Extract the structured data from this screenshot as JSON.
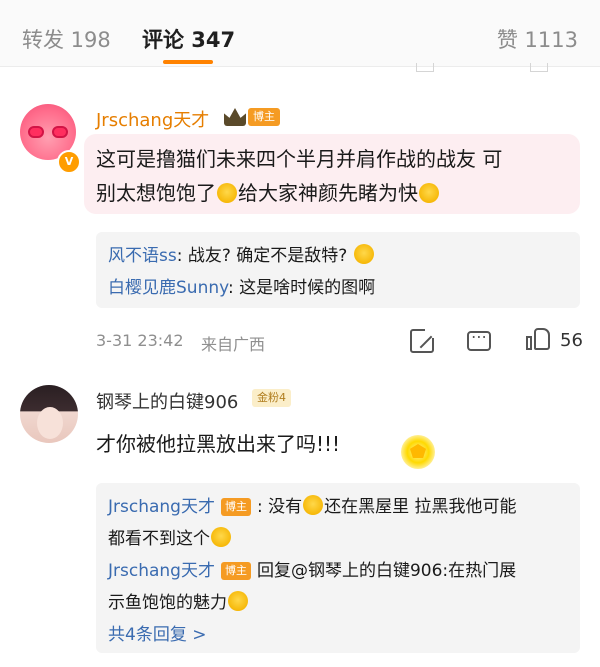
{
  "tabs": {
    "repost": "转发 198",
    "comments": "评论 347",
    "likes": "赞 1113"
  },
  "colors": {
    "accent": "#ff8200",
    "link": "#3a6bb0",
    "username_vip": "#e67e00"
  },
  "comments": [
    {
      "user": "Jrschang天才",
      "badge": "博主",
      "text_line1": "这可是撸猫们未来四个半月并肩作战的战友 可",
      "text_line2a": "别太想饱饱了",
      "text_line2b": "给大家神颜先睹为快",
      "replies": [
        {
          "name": "风不语ss",
          "text": ": 战友? 确定不是敌特? "
        },
        {
          "name": "白樱见鹿Sunny",
          "text": ": 这是啥时候的图啊"
        }
      ],
      "time": "3-31 23:42",
      "location": "来自广西",
      "like_count": "56"
    },
    {
      "user": "钢琴上的白键906",
      "fan_badge": "金粉4",
      "text": "才你被他拉黑放出来了吗!!!",
      "replies": [
        {
          "name": "Jrschang天才",
          "tag": "博主",
          "text_a": ": 没有",
          "text_b": "还在黑屋里 拉黑我他可能",
          "text_c": "都看不到这个"
        },
        {
          "name": "Jrschang天才",
          "tag": "博主",
          "text_a": "回复@钢琴上的白键906:在热门展",
          "text_c": "示鱼饱饱的魅力"
        }
      ],
      "more": "共4条回复 >"
    }
  ]
}
